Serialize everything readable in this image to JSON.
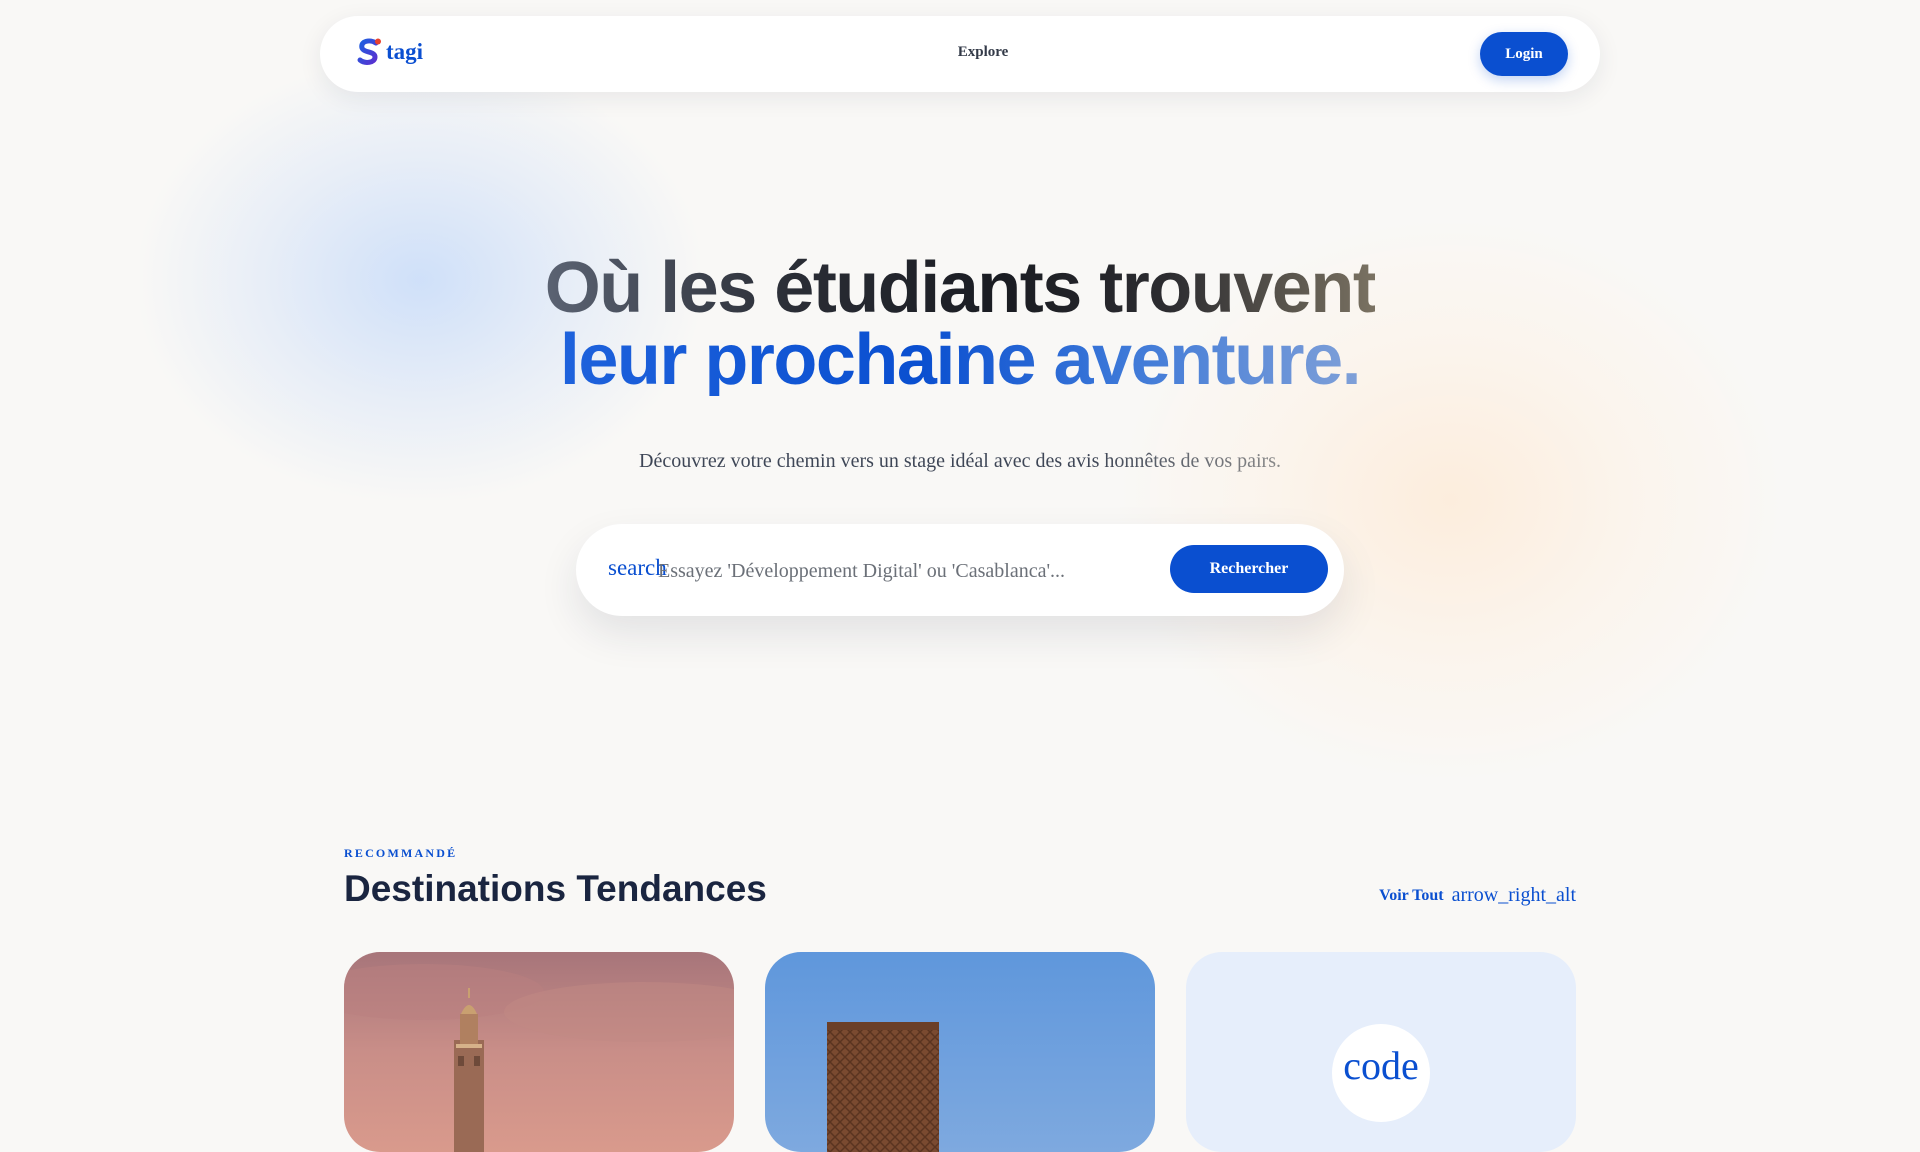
{
  "nav": {
    "logo_text": "tagi",
    "links": [
      {
        "label": "Explore"
      }
    ],
    "login_label": "Login"
  },
  "hero": {
    "title_line1": "Où les étudiants trouvent",
    "title_line2": "leur prochaine aventure.",
    "subtitle": "Découvrez votre chemin vers un stage idéal avec des avis honnêtes de vos pairs."
  },
  "search": {
    "icon_name": "search",
    "placeholder": "Essayez 'Développement Digital' ou 'Casablanca'...",
    "button_label": "Rechercher"
  },
  "section": {
    "eyebrow": "RECOMMANDÉ",
    "title": "Destinations Tendances",
    "see_all_label": "Voir Tout",
    "see_all_icon": "arrow_right_alt"
  },
  "cards": [
    {
      "image": "minaret-sunset-photo"
    },
    {
      "image": "hassan-tower-photo"
    },
    {
      "icon_name": "code"
    }
  ],
  "colors": {
    "accent": "#0a4fd0",
    "background": "#f9f8f6",
    "title_dark": "#1a2540",
    "card_tint": "#e6eefb"
  }
}
